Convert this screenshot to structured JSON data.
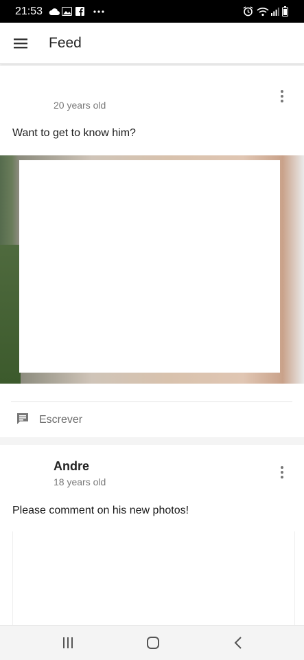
{
  "status_bar": {
    "time": "21:53",
    "left_icons": [
      "cloud-icon",
      "gallery-icon",
      "facebook-icon",
      "more-icon"
    ],
    "right_icons": [
      "alarm-icon",
      "wifi-icon",
      "signal-icon",
      "battery-icon"
    ]
  },
  "app_bar": {
    "title": "Feed",
    "menu_icon": "hamburger-menu-icon"
  },
  "posts": [
    {
      "name": "",
      "age": "20 years old",
      "text": "Want to get to know him?",
      "write_label": "Escrever"
    },
    {
      "name": "Andre",
      "age": "18 years old",
      "text": "Please comment on his new photos!"
    }
  ],
  "nav_bar": {
    "icons": [
      "recent-apps-icon",
      "home-icon",
      "back-icon"
    ]
  }
}
